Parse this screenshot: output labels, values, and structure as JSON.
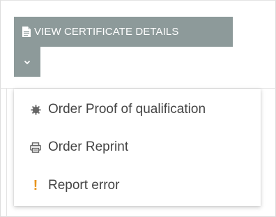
{
  "header": {
    "view_button_label": "VIEW CERTIFICATE DETAILS",
    "view_icon": "document-icon",
    "toggle_icon": "chevron-down-icon"
  },
  "menu": {
    "items": [
      {
        "label": "Order Proof of qualification",
        "icon": "gear-icon"
      },
      {
        "label": "Order Reprint",
        "icon": "printer-icon"
      },
      {
        "label": "Report error",
        "icon": "exclamation-icon",
        "icon_glyph": "!"
      }
    ]
  },
  "colors": {
    "button_bg": "#8d9a9a",
    "text": "#444444",
    "warning": "#e8951e"
  }
}
